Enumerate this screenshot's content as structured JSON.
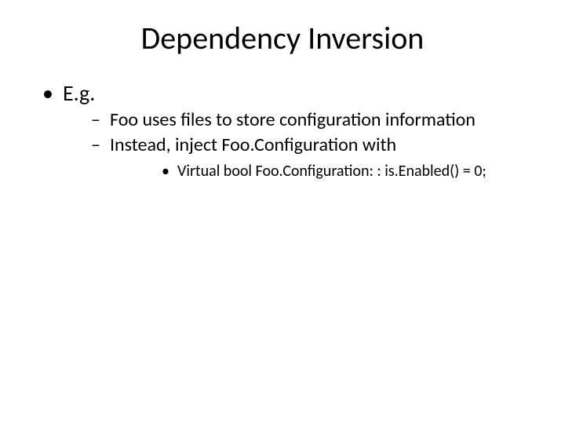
{
  "title": "Dependency Inversion",
  "lvl1": {
    "item0": "E.g."
  },
  "lvl2": {
    "item0": "Foo uses files to store configuration information",
    "item1": "Instead, inject Foo.Configuration with"
  },
  "lvl3": {
    "item0": "Virtual bool Foo.Configuration: : is.Enabled() = 0;"
  }
}
